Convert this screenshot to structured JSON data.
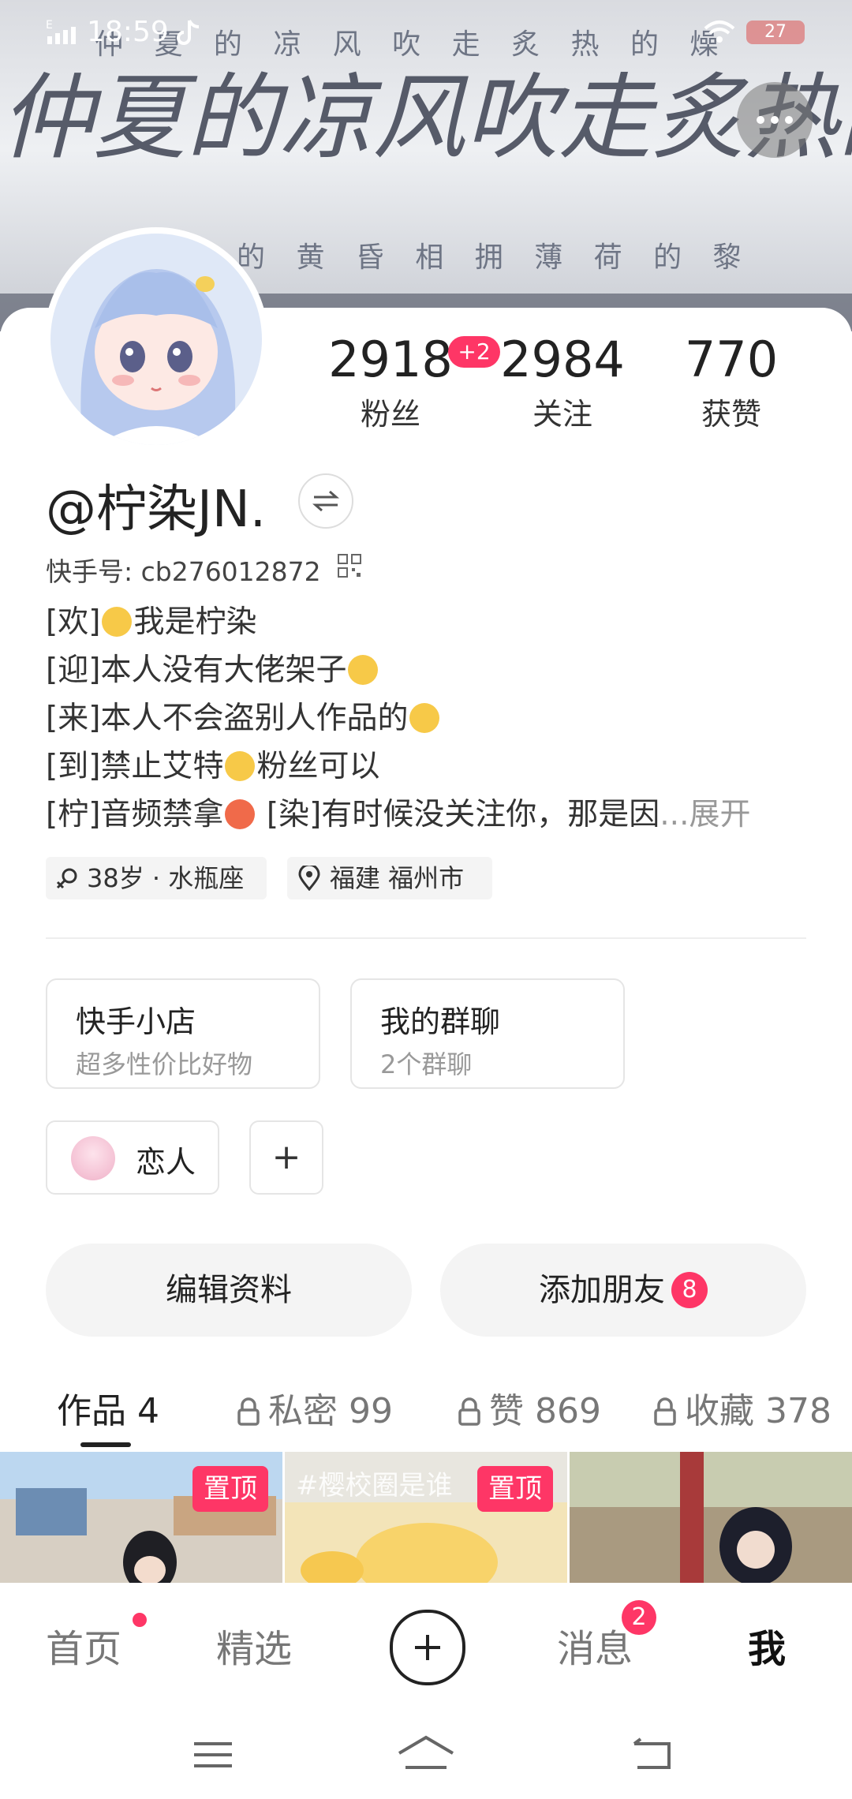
{
  "status_bar": {
    "time": "18:59",
    "carrier": "E",
    "battery": "27"
  },
  "banner": {
    "text_row_1": "仲 夏 的 凉 风 吹 走 炙 热 的 燥",
    "calligraphy": "仲夏的凉风吹走炙热的",
    "text_row_2": "的 黄 昏 相 拥 薄 荷 的 黎"
  },
  "profile": {
    "username": "@柠染JN.",
    "kuaishou_id": "快手号: cb276012872",
    "stats": [
      {
        "value": "2918",
        "label": "粉丝"
      },
      {
        "value": "2984",
        "label": "关注"
      },
      {
        "value": "770",
        "label": "获赞"
      }
    ],
    "new_followers_badge": "+2",
    "bio": {
      "line1_prefix": "[欢]",
      "line1_text": "我是柠染",
      "line2_prefix": "[迎]",
      "line2_text": "本人没有大佬架子",
      "line3_prefix": "[来]",
      "line3_text": "本人不会盗别人作品的",
      "line4_prefix": "[到]",
      "line4_text_a": "禁止艾特",
      "line4_text_b": "粉丝可以",
      "line5_prefix": "[柠]",
      "line5_text_a": "音频禁拿",
      "line5_text_b": " [染]有时候没关注你，那是因",
      "ellipsis": "...",
      "expand": "展开"
    },
    "tags": {
      "age": "38岁 · 水瓶座",
      "location": "福建 福州市"
    }
  },
  "entries": [
    {
      "title": "快手小店",
      "subtitle": "超多性价比好物"
    },
    {
      "title": "我的群聊",
      "subtitle": "2个群聊"
    }
  ],
  "relation": {
    "label": "恋人",
    "add": "+"
  },
  "actions": {
    "edit": "编辑资料",
    "add_friend": "添加朋友",
    "add_friend_badge": "8"
  },
  "tabs": [
    {
      "label": "作品 4"
    },
    {
      "label": "私密 99"
    },
    {
      "label": "赞 869"
    },
    {
      "label": "收藏 378"
    }
  ],
  "grid": {
    "pin_label": "置顶",
    "thumb2_caption": "#樱校圈是谁"
  },
  "bottom_nav": {
    "home": "首页",
    "featured": "精选",
    "messages": "消息",
    "messages_badge": "2",
    "me": "我"
  },
  "colors": {
    "accent": "#fe3666",
    "text": "#222222",
    "muted": "#999999",
    "pill_bg": "#f4f4f4"
  },
  "icons": [
    "signal-icon",
    "tiktok-icon",
    "wifi-icon",
    "battery-icon",
    "more-icon",
    "switch-account-icon",
    "qr-code-icon",
    "gender-icon",
    "location-icon",
    "lock-icon",
    "plus-icon",
    "menu-icon",
    "home-icon",
    "back-icon"
  ]
}
